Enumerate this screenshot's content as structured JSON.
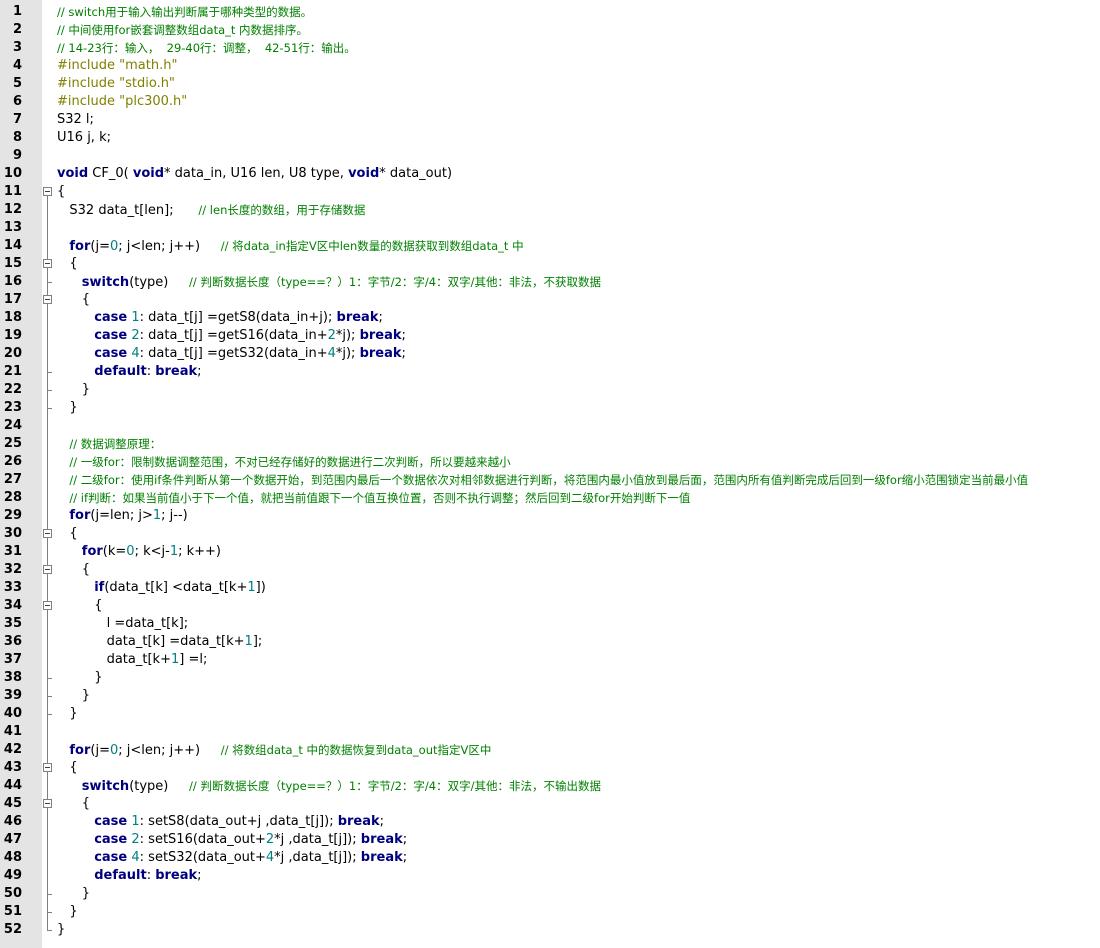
{
  "editor": {
    "lines": [
      {
        "n": "1",
        "indent": "",
        "t": [
          [
            "cm",
            "// switch用于输入输出判断属于哪种类型的数据。"
          ]
        ]
      },
      {
        "n": "2",
        "indent": "",
        "t": [
          [
            "cm",
            "// 中间使用for嵌套调整数组data_t 内数据排序。"
          ]
        ]
      },
      {
        "n": "3",
        "indent": "",
        "t": [
          [
            "cm",
            "// 14-23行：输入，  29-40行：调整，  42-51行：输出。"
          ]
        ]
      },
      {
        "n": "4",
        "indent": "",
        "t": [
          [
            "pp",
            "#include \"math.h\""
          ]
        ]
      },
      {
        "n": "5",
        "indent": "",
        "t": [
          [
            "pp",
            "#include \"stdio.h\""
          ]
        ]
      },
      {
        "n": "6",
        "indent": "",
        "t": [
          [
            "pp",
            "#include \"plc300.h\""
          ]
        ]
      },
      {
        "n": "7",
        "indent": "",
        "t": [
          [
            "p",
            "S32 l;"
          ]
        ]
      },
      {
        "n": "8",
        "indent": "",
        "t": [
          [
            "p",
            "U16 j, k;"
          ]
        ]
      },
      {
        "n": "9",
        "indent": "",
        "t": []
      },
      {
        "n": "10",
        "indent": "",
        "t": [
          [
            "kw",
            "void"
          ],
          [
            "p",
            " CF_0( "
          ],
          [
            "kw",
            "void"
          ],
          [
            "p",
            "* data_in, U16 len, U8 type, "
          ],
          [
            "kw",
            "void"
          ],
          [
            "p",
            "* data_out)"
          ]
        ]
      },
      {
        "n": "11",
        "indent": "",
        "t": [
          [
            "p",
            "{"
          ]
        ]
      },
      {
        "n": "12",
        "indent": "   ",
        "t": [
          [
            "p",
            "S32 data_t[len];      "
          ],
          [
            "cm",
            "// len长度的数组，用于存储数据"
          ]
        ]
      },
      {
        "n": "13",
        "indent": "",
        "t": []
      },
      {
        "n": "14",
        "indent": "   ",
        "t": [
          [
            "kw",
            "for"
          ],
          [
            "p",
            "(j="
          ],
          [
            "num",
            "0"
          ],
          [
            "p",
            "; j<len; j++)     "
          ],
          [
            "cm",
            "// 将data_in指定V区中len数量的数据获取到数组data_t 中"
          ]
        ]
      },
      {
        "n": "15",
        "indent": "   ",
        "t": [
          [
            "p",
            "{"
          ]
        ]
      },
      {
        "n": "16",
        "indent": "      ",
        "t": [
          [
            "kw",
            "switch"
          ],
          [
            "p",
            "(type)     "
          ],
          [
            "cm",
            "// 判断数据长度（type==？）1：字节/2：字/4：双字/其他：非法，不获取数据"
          ]
        ]
      },
      {
        "n": "17",
        "indent": "      ",
        "t": [
          [
            "p",
            "{"
          ]
        ]
      },
      {
        "n": "18",
        "indent": "         ",
        "t": [
          [
            "kw",
            "case"
          ],
          [
            "p",
            " "
          ],
          [
            "num",
            "1"
          ],
          [
            "p",
            ": data_t[j] =getS8(data_in+j); "
          ],
          [
            "kw",
            "break"
          ],
          [
            "p",
            ";"
          ]
        ]
      },
      {
        "n": "19",
        "indent": "         ",
        "t": [
          [
            "kw",
            "case"
          ],
          [
            "p",
            " "
          ],
          [
            "num",
            "2"
          ],
          [
            "p",
            ": data_t[j] =getS16(data_in+"
          ],
          [
            "num",
            "2"
          ],
          [
            "p",
            "*j); "
          ],
          [
            "kw",
            "break"
          ],
          [
            "p",
            ";"
          ]
        ]
      },
      {
        "n": "20",
        "indent": "         ",
        "t": [
          [
            "kw",
            "case"
          ],
          [
            "p",
            " "
          ],
          [
            "num",
            "4"
          ],
          [
            "p",
            ": data_t[j] =getS32(data_in+"
          ],
          [
            "num",
            "4"
          ],
          [
            "p",
            "*j); "
          ],
          [
            "kw",
            "break"
          ],
          [
            "p",
            ";"
          ]
        ]
      },
      {
        "n": "21",
        "indent": "         ",
        "t": [
          [
            "kw",
            "default"
          ],
          [
            "p",
            ": "
          ],
          [
            "kw",
            "break"
          ],
          [
            "p",
            ";"
          ]
        ]
      },
      {
        "n": "22",
        "indent": "      ",
        "t": [
          [
            "p",
            "}"
          ]
        ]
      },
      {
        "n": "23",
        "indent": "   ",
        "t": [
          [
            "p",
            "}"
          ]
        ]
      },
      {
        "n": "24",
        "indent": "",
        "t": []
      },
      {
        "n": "25",
        "indent": "   ",
        "t": [
          [
            "cm",
            "// 数据调整原理："
          ]
        ]
      },
      {
        "n": "26",
        "indent": "   ",
        "t": [
          [
            "cm",
            "// 一级for：限制数据调整范围，不对已经存储好的数据进行二次判断，所以要越来越小"
          ]
        ]
      },
      {
        "n": "27",
        "indent": "   ",
        "t": [
          [
            "cm",
            "// 二级for：使用if条件判断从第一个数据开始，到范围内最后一个数据依次对相邻数据进行判断，将范围内最小值放到最后面，范围内所有值判断完成后回到一级for缩小范围锁定当前最小值"
          ]
        ]
      },
      {
        "n": "28",
        "indent": "   ",
        "t": [
          [
            "cm",
            "// if判断：如果当前值小于下一个值，就把当前值跟下一个值互换位置，否则不执行调整；然后回到二级for开始判断下一值"
          ]
        ]
      },
      {
        "n": "29",
        "indent": "   ",
        "t": [
          [
            "kw",
            "for"
          ],
          [
            "p",
            "(j=len; j>"
          ],
          [
            "num",
            "1"
          ],
          [
            "p",
            "; j--)"
          ]
        ]
      },
      {
        "n": "30",
        "indent": "   ",
        "t": [
          [
            "p",
            "{"
          ]
        ]
      },
      {
        "n": "31",
        "indent": "      ",
        "t": [
          [
            "kw",
            "for"
          ],
          [
            "p",
            "(k="
          ],
          [
            "num",
            "0"
          ],
          [
            "p",
            "; k<j-"
          ],
          [
            "num",
            "1"
          ],
          [
            "p",
            "; k++)"
          ]
        ]
      },
      {
        "n": "32",
        "indent": "      ",
        "t": [
          [
            "p",
            "{"
          ]
        ]
      },
      {
        "n": "33",
        "indent": "         ",
        "t": [
          [
            "kw",
            "if"
          ],
          [
            "p",
            "(data_t[k] <data_t[k+"
          ],
          [
            "num",
            "1"
          ],
          [
            "p",
            "])"
          ]
        ]
      },
      {
        "n": "34",
        "indent": "         ",
        "t": [
          [
            "p",
            "{"
          ]
        ]
      },
      {
        "n": "35",
        "indent": "            ",
        "t": [
          [
            "p",
            "l =data_t[k];"
          ]
        ]
      },
      {
        "n": "36",
        "indent": "            ",
        "t": [
          [
            "p",
            "data_t[k] =data_t[k+"
          ],
          [
            "num",
            "1"
          ],
          [
            "p",
            "];"
          ]
        ]
      },
      {
        "n": "37",
        "indent": "            ",
        "t": [
          [
            "p",
            "data_t[k+"
          ],
          [
            "num",
            "1"
          ],
          [
            "p",
            "] =l;"
          ]
        ]
      },
      {
        "n": "38",
        "indent": "         ",
        "t": [
          [
            "p",
            "}"
          ]
        ]
      },
      {
        "n": "39",
        "indent": "      ",
        "t": [
          [
            "p",
            "}"
          ]
        ]
      },
      {
        "n": "40",
        "indent": "   ",
        "t": [
          [
            "p",
            "}"
          ]
        ]
      },
      {
        "n": "41",
        "indent": "",
        "t": []
      },
      {
        "n": "42",
        "indent": "   ",
        "t": [
          [
            "kw",
            "for"
          ],
          [
            "p",
            "(j="
          ],
          [
            "num",
            "0"
          ],
          [
            "p",
            "; j<len; j++)     "
          ],
          [
            "cm",
            "// 将数组data_t 中的数据恢复到data_out指定V区中"
          ]
        ]
      },
      {
        "n": "43",
        "indent": "   ",
        "t": [
          [
            "p",
            "{"
          ]
        ]
      },
      {
        "n": "44",
        "indent": "      ",
        "t": [
          [
            "kw",
            "switch"
          ],
          [
            "p",
            "(type)     "
          ],
          [
            "cm",
            "// 判断数据长度（type==？）1：字节/2：字/4：双字/其他：非法，不输出数据"
          ]
        ]
      },
      {
        "n": "45",
        "indent": "      ",
        "t": [
          [
            "p",
            "{"
          ]
        ]
      },
      {
        "n": "46",
        "indent": "         ",
        "t": [
          [
            "kw",
            "case"
          ],
          [
            "p",
            " "
          ],
          [
            "num",
            "1"
          ],
          [
            "p",
            ": setS8(data_out+j ,data_t[j]); "
          ],
          [
            "kw",
            "break"
          ],
          [
            "p",
            ";"
          ]
        ]
      },
      {
        "n": "47",
        "indent": "         ",
        "t": [
          [
            "kw",
            "case"
          ],
          [
            "p",
            " "
          ],
          [
            "num",
            "2"
          ],
          [
            "p",
            ": setS16(data_out+"
          ],
          [
            "num",
            "2"
          ],
          [
            "p",
            "*j ,data_t[j]); "
          ],
          [
            "kw",
            "break"
          ],
          [
            "p",
            ";"
          ]
        ]
      },
      {
        "n": "48",
        "indent": "         ",
        "t": [
          [
            "kw",
            "case"
          ],
          [
            "p",
            " "
          ],
          [
            "num",
            "4"
          ],
          [
            "p",
            ": setS32(data_out+"
          ],
          [
            "num",
            "4"
          ],
          [
            "p",
            "*j ,data_t[j]); "
          ],
          [
            "kw",
            "break"
          ],
          [
            "p",
            ";"
          ]
        ]
      },
      {
        "n": "49",
        "indent": "         ",
        "t": [
          [
            "kw",
            "default"
          ],
          [
            "p",
            ": "
          ],
          [
            "kw",
            "break"
          ],
          [
            "p",
            ";"
          ]
        ]
      },
      {
        "n": "50",
        "indent": "      ",
        "t": [
          [
            "p",
            "}"
          ]
        ]
      },
      {
        "n": "51",
        "indent": "   ",
        "t": [
          [
            "p",
            "}"
          ]
        ]
      },
      {
        "n": "52",
        "indent": "",
        "t": [
          [
            "p",
            "}"
          ]
        ]
      }
    ]
  }
}
